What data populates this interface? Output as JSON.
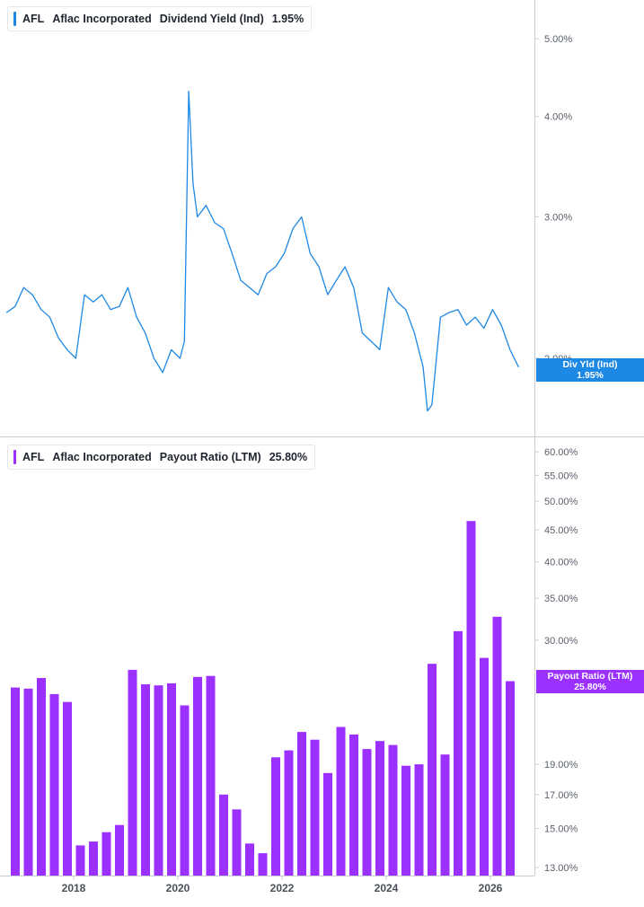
{
  "colors": {
    "yield": "#1e88e5",
    "payout": "#9b30ff",
    "axis_text": "#5a606b",
    "divider": "#c8ccd2"
  },
  "top_panel": {
    "ticker": "AFL",
    "company": "Aflac Incorporated",
    "metric": "Dividend Yield (Ind)",
    "value": "1.95%",
    "flag_label": "Div Yld (Ind)",
    "flag_value": "1.95%"
  },
  "bottom_panel": {
    "ticker": "AFL",
    "company": "Aflac Incorporated",
    "metric": "Payout Ratio (LTM)",
    "value": "25.80%",
    "flag_label": "Payout Ratio (LTM)",
    "flag_value": "25.80%"
  },
  "x_axis_labels": [
    "2018",
    "2020",
    "2022",
    "2024",
    "2026"
  ],
  "chart_data": [
    {
      "type": "line",
      "title": "Dividend Yield (Ind)",
      "yscale": "log",
      "y_ticks": [
        "5.00%",
        "4.00%",
        "3.00%",
        "2.00%"
      ],
      "y_tick_values": [
        5.0,
        4.0,
        3.0,
        2.0
      ],
      "x": [
        "2016-09",
        "2016-11",
        "2017-01",
        "2017-03",
        "2017-05",
        "2017-07",
        "2017-09",
        "2017-11",
        "2018-01",
        "2018-03",
        "2018-05",
        "2018-07",
        "2018-09",
        "2018-11",
        "2019-01",
        "2019-03",
        "2019-05",
        "2019-07",
        "2019-09",
        "2019-11",
        "2020-01",
        "2020-02",
        "2020-03",
        "2020-04",
        "2020-05",
        "2020-07",
        "2020-09",
        "2020-11",
        "2021-01",
        "2021-03",
        "2021-05",
        "2021-07",
        "2021-09",
        "2021-11",
        "2022-01",
        "2022-03",
        "2022-05",
        "2022-07",
        "2022-09",
        "2022-11",
        "2023-01",
        "2023-03",
        "2023-05",
        "2023-07",
        "2023-09",
        "2023-11",
        "2024-01",
        "2024-03",
        "2024-05",
        "2024-07",
        "2024-09",
        "2024-10",
        "2024-11",
        "2025-01",
        "2025-03",
        "2025-05",
        "2025-07",
        "2025-09",
        "2025-11",
        "2026-01",
        "2026-03",
        "2026-05",
        "2026-07"
      ],
      "values": [
        2.28,
        2.32,
        2.45,
        2.4,
        2.3,
        2.25,
        2.12,
        2.05,
        2.0,
        2.4,
        2.35,
        2.4,
        2.3,
        2.32,
        2.45,
        2.25,
        2.15,
        2.0,
        1.92,
        2.05,
        2.0,
        2.1,
        4.3,
        3.3,
        3.0,
        3.1,
        2.95,
        2.9,
        2.7,
        2.5,
        2.45,
        2.4,
        2.55,
        2.6,
        2.7,
        2.9,
        3.0,
        2.7,
        2.6,
        2.4,
        2.5,
        2.6,
        2.45,
        2.15,
        2.1,
        2.05,
        2.45,
        2.35,
        2.3,
        2.15,
        1.95,
        1.72,
        1.75,
        2.25,
        2.28,
        2.3,
        2.2,
        2.25,
        2.18,
        2.3,
        2.2,
        2.05,
        1.95
      ]
    },
    {
      "type": "bar",
      "title": "Payout Ratio (LTM)",
      "yscale": "log",
      "y_ticks": [
        "60.00%",
        "55.00%",
        "50.00%",
        "45.00%",
        "40.00%",
        "35.00%",
        "30.00%",
        "25.00%",
        "19.00%",
        "17.00%",
        "15.00%",
        "13.00%"
      ],
      "y_tick_values": [
        60,
        55,
        50,
        45,
        40,
        35,
        30,
        25,
        19,
        17,
        15,
        13
      ],
      "categories": [
        "2016 Q4",
        "2017 Q1",
        "2017 Q2",
        "2017 Q3",
        "2017 Q4",
        "2018 Q1",
        "2018 Q2",
        "2018 Q3",
        "2018 Q4",
        "2019 Q1",
        "2019 Q2",
        "2019 Q3",
        "2019 Q4",
        "2020 Q1",
        "2020 Q2",
        "2020 Q3",
        "2020 Q4",
        "2021 Q1",
        "2021 Q2",
        "2021 Q3",
        "2021 Q4",
        "2022 Q1",
        "2022 Q2",
        "2022 Q3",
        "2022 Q4",
        "2023 Q1",
        "2023 Q2",
        "2023 Q3",
        "2023 Q4",
        "2024 Q1",
        "2024 Q2",
        "2024 Q3",
        "2024 Q4",
        "2025 Q1",
        "2025 Q2",
        "2025 Q3",
        "2025 Q4",
        "2026 Q1",
        "2026 Q2"
      ],
      "x_positions": [
        2016.88,
        2017.13,
        2017.38,
        2017.63,
        2017.88,
        2018.13,
        2018.38,
        2018.63,
        2018.88,
        2019.13,
        2019.38,
        2019.63,
        2019.88,
        2020.13,
        2020.38,
        2020.63,
        2020.88,
        2021.13,
        2021.38,
        2021.63,
        2021.88,
        2022.13,
        2022.38,
        2022.63,
        2022.88,
        2023.13,
        2023.38,
        2023.63,
        2023.88,
        2024.13,
        2024.38,
        2024.63,
        2024.88,
        2025.13,
        2025.38,
        2025.63,
        2025.88,
        2026.13,
        2026.38
      ],
      "values": [
        25.2,
        25.1,
        26.1,
        24.6,
        23.9,
        14.1,
        14.3,
        14.8,
        15.2,
        26.9,
        25.5,
        25.4,
        25.6,
        23.6,
        26.2,
        26.3,
        17.0,
        16.1,
        14.2,
        13.7,
        19.5,
        20.0,
        21.4,
        20.8,
        18.4,
        21.8,
        21.2,
        20.1,
        20.7,
        20.4,
        18.9,
        19.0,
        27.5,
        19.7,
        31.0,
        46.5,
        28.1,
        32.7,
        25.8
      ]
    }
  ]
}
